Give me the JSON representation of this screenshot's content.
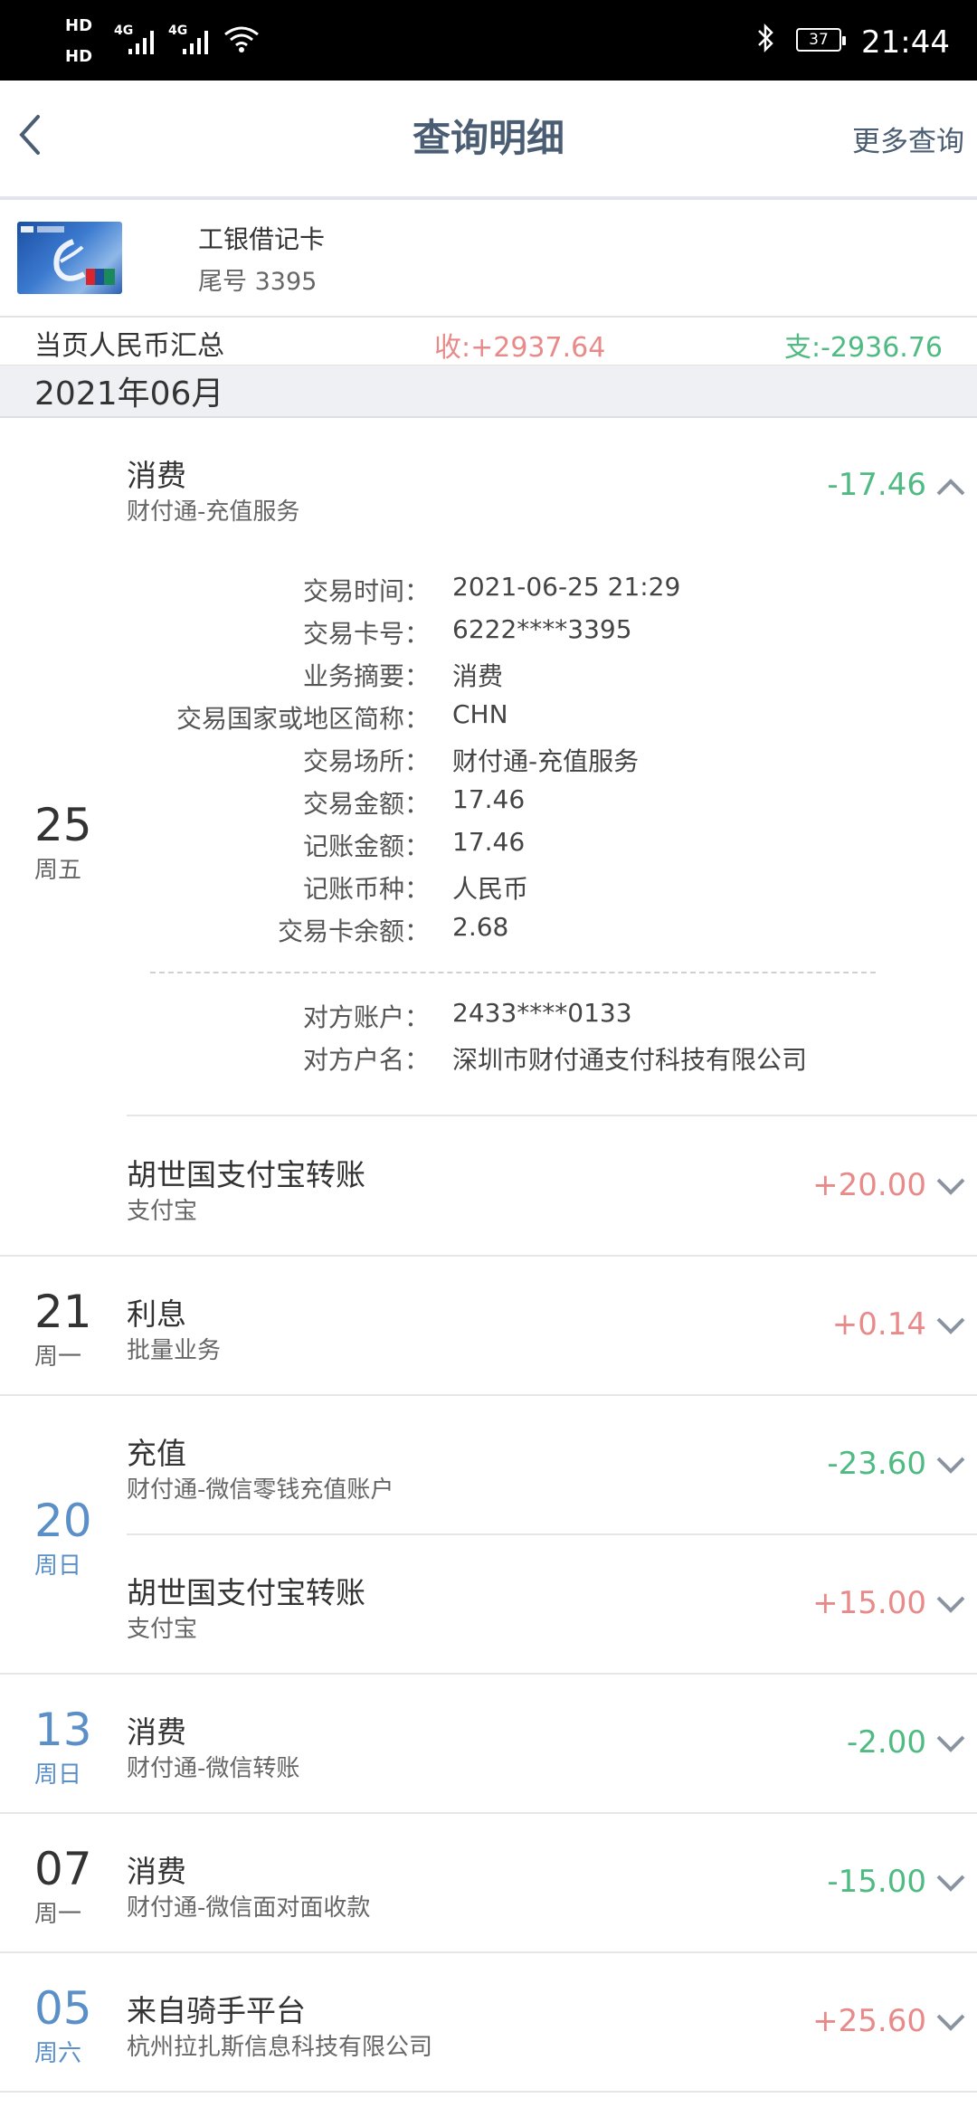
{
  "status_bar": {
    "time": "21:44",
    "battery": "37",
    "network1": "4G",
    "network2": "4G",
    "hd1": "HD",
    "hd2": "HD",
    "icons": [
      "signal-icon",
      "wifi-icon",
      "bluetooth-icon",
      "battery-icon"
    ]
  },
  "header": {
    "title": "查询明细",
    "more": "更多查询"
  },
  "card": {
    "name": "工银借记卡",
    "tail": "尾号 3395"
  },
  "summary": {
    "label": "当页人民币汇总",
    "income": "收:+2937.64",
    "expense": "支:-2936.76"
  },
  "month": "2021年06月",
  "groups": [
    {
      "day": "25",
      "weekday": "周五",
      "transactions": [
        {
          "title": "消费",
          "sub": "财付通-充值服务",
          "amount": "-17.46",
          "expanded": true,
          "details": [
            {
              "k": "交易时间：",
              "v": "2021-06-25 21:29"
            },
            {
              "k": "交易卡号：",
              "v": "6222****3395"
            },
            {
              "k": "业务摘要：",
              "v": "消费"
            },
            {
              "k": "交易国家或地区简称：",
              "v": "CHN"
            },
            {
              "k": "交易场所：",
              "v": "财付通-充值服务"
            },
            {
              "k": "交易金额：",
              "v": "17.46"
            },
            {
              "k": "记账金额：",
              "v": "17.46"
            },
            {
              "k": "记账币种：",
              "v": "人民币"
            },
            {
              "k": "交易卡余额：",
              "v": "2.68"
            }
          ],
          "counterparty": [
            {
              "k": "对方账户：",
              "v": "2433****0133"
            },
            {
              "k": "对方户名：",
              "v": "深圳市财付通支付科技有限公司"
            }
          ]
        },
        {
          "title": "胡世国支付宝转账",
          "sub": "支付宝",
          "amount": "+20.00"
        }
      ]
    },
    {
      "day": "21",
      "weekday": "周一",
      "transactions": [
        {
          "title": "利息",
          "sub": "批量业务",
          "amount": "+0.14"
        }
      ]
    },
    {
      "day": "20",
      "weekday": "周日",
      "transactions": [
        {
          "title": "充值",
          "sub": "财付通-微信零钱充值账户",
          "amount": "-23.60"
        },
        {
          "title": "胡世国支付宝转账",
          "sub": "支付宝",
          "amount": "+15.00"
        }
      ]
    },
    {
      "day": "13",
      "weekday": "周日",
      "transactions": [
        {
          "title": "消费",
          "sub": "财付通-微信转账",
          "amount": "-2.00"
        }
      ]
    },
    {
      "day": "07",
      "weekday": "周一",
      "transactions": [
        {
          "title": "消费",
          "sub": "财付通-微信面对面收款",
          "amount": "-15.00"
        }
      ]
    },
    {
      "day": "05",
      "weekday": "周六",
      "transactions": [
        {
          "title": "来自骑手平台",
          "sub": "杭州拉扎斯信息科技有限公司",
          "amount": "+25.60"
        }
      ]
    }
  ],
  "colors": {
    "header_text": "#4b5d73",
    "income": "#e88a89",
    "expense": "#4fba82",
    "weekend_day": "#5a8fc7",
    "month_bar": "#eef0f4"
  }
}
